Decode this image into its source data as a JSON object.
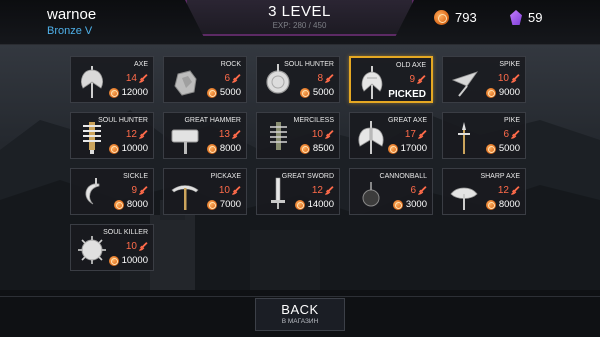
{
  "player": {
    "name": "warnoe",
    "rank": "Bronze V"
  },
  "level": {
    "label": "3 LEVEL",
    "exp": "EXP: 280 / 450"
  },
  "currency": {
    "coins": "793",
    "gems": "59"
  },
  "colors": {
    "accent_gold": "#e5a823",
    "power_red": "#ff6b4a",
    "rank_blue": "#4fb0e8",
    "coin_orange": "#e07020",
    "gem_purple": "#a35be8"
  },
  "weapons": [
    {
      "name": "AXE",
      "power": "14",
      "price": "12000",
      "picked": false,
      "icon": "axe-icon"
    },
    {
      "name": "ROCK",
      "power": "6",
      "price": "5000",
      "picked": false,
      "icon": "rock-icon"
    },
    {
      "name": "SOUL HUNTER",
      "power": "8",
      "price": "5000",
      "picked": false,
      "icon": "round-flail-icon"
    },
    {
      "name": "OLD AXE",
      "power": "9",
      "price": "",
      "picked": true,
      "picked_label": "PICKED",
      "icon": "old-axe-icon"
    },
    {
      "name": "SPIKE",
      "power": "10",
      "price": "9000",
      "picked": false,
      "icon": "spike-icon"
    },
    {
      "name": "SOUL HUNTER",
      "power": "12",
      "price": "10000",
      "picked": false,
      "icon": "spiked-club-icon"
    },
    {
      "name": "GREAT HAMMER",
      "power": "13",
      "price": "8000",
      "picked": false,
      "icon": "hammer-icon"
    },
    {
      "name": "MERCILESS",
      "power": "10",
      "price": "8500",
      "picked": false,
      "icon": "spiked-mace-icon"
    },
    {
      "name": "GREAT AXE",
      "power": "17",
      "price": "17000",
      "picked": false,
      "icon": "double-axe-icon"
    },
    {
      "name": "PIKE",
      "power": "6",
      "price": "5000",
      "picked": false,
      "icon": "pike-icon"
    },
    {
      "name": "SICKLE",
      "power": "9",
      "price": "8000",
      "picked": false,
      "icon": "sickle-icon"
    },
    {
      "name": "PICKAXE",
      "power": "10",
      "price": "7000",
      "picked": false,
      "icon": "pickaxe-icon"
    },
    {
      "name": "GREAT SWORD",
      "power": "12",
      "price": "14000",
      "picked": false,
      "icon": "great-sword-icon"
    },
    {
      "name": "CANNONBALL",
      "power": "6",
      "price": "3000",
      "picked": false,
      "icon": "cannonball-icon"
    },
    {
      "name": "SHARP AXE",
      "power": "12",
      "price": "8000",
      "picked": false,
      "icon": "sharp-axe-icon"
    },
    {
      "name": "SOUL KILLER",
      "power": "10",
      "price": "10000",
      "picked": false,
      "icon": "spiked-ball-icon"
    }
  ],
  "back_button": {
    "label": "BACK",
    "sublabel": "В МАГАЗИН"
  }
}
